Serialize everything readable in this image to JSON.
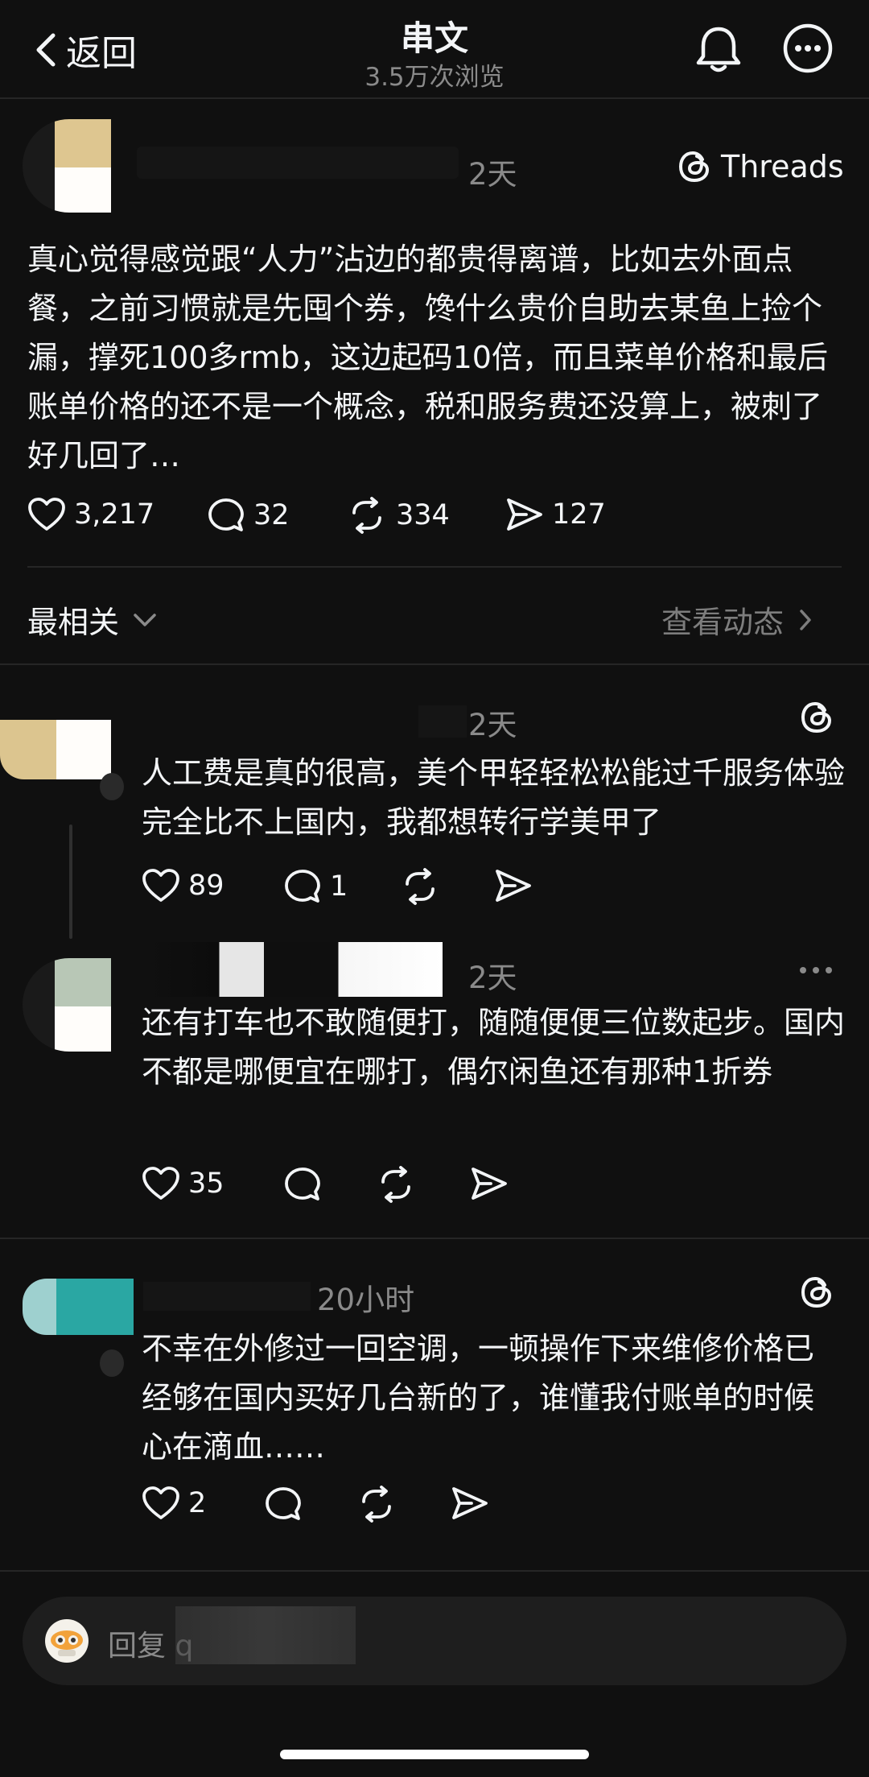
{
  "header": {
    "back_label": "返回",
    "title": "串文",
    "views": "3.5万次浏览"
  },
  "main_post": {
    "time": "2天",
    "brand_label": "Threads",
    "text": "真心觉得感觉跟“人力”沾边的都贵得离谱，比如去外面点餐，之前习惯就是先囤个券，馋什么贵价自助去某鱼上捡个漏，撑死100多rmb，这边起码10倍，而且菜单价格和最后账单价格的还不是一个概念，税和服务费还没算上，被刺了好几回了…",
    "likes": "3,217",
    "comments": "32",
    "reposts": "334",
    "shares": "127"
  },
  "sort_bar": {
    "sort_label": "最相关",
    "activity_label": "查看动态"
  },
  "replies": [
    {
      "time": "2天",
      "text": "人工费是真的很高，美个甲轻轻松松能过千服务体验完全比不上国内，我都想转行学美甲了",
      "likes": "89",
      "comments": "1"
    },
    {
      "time": "2天",
      "text": "还有打车也不敢随便打，随随便便三位数起步。国内不都是哪便宜在哪打，偶尔闲鱼还有那种1折券",
      "likes": "35"
    },
    {
      "time": "20小时",
      "text": "不幸在外修过一回空调，一顿操作下来维修价格已经够在国内买好几台新的了，谁懂我付账单的时候心在滴血……",
      "likes": "2"
    }
  ],
  "reply_bar": {
    "placeholder": "回复 q"
  },
  "colors": {
    "background": "#101010",
    "text": "#f3f5f7",
    "secondary": "#8a8a8a",
    "divider": "#262626"
  }
}
